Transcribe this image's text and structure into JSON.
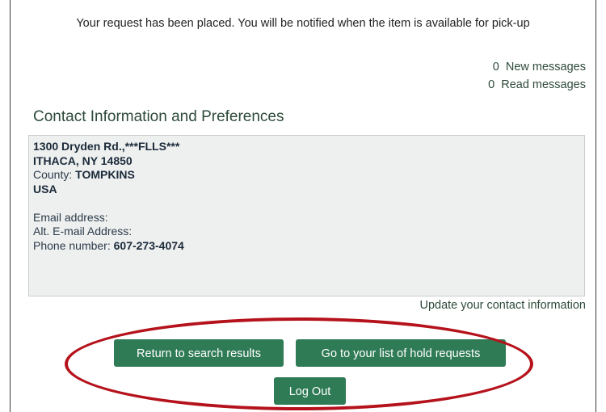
{
  "notice": "Your request has been placed. You will be notified when the item is available for pick-up",
  "messages": {
    "new_count": "0",
    "new_label": "New messages",
    "read_count": "0",
    "read_label": "Read messages"
  },
  "contact": {
    "title": "Contact Information and Preferences",
    "address_line1": "1300 Dryden Rd.,***FLLS***",
    "address_line2": "ITHACA, NY  14850",
    "county_label": "County: ",
    "county_value": "TOMPKINS",
    "country": "USA",
    "email_label": "Email address:",
    "alt_email_label": "Alt. E-mail Address:",
    "phone_label": "Phone number: ",
    "phone_value": "607-273-4074",
    "update_link": "Update your contact information"
  },
  "buttons": {
    "return_label": "Return to search results",
    "hold_label": "Go to your list of hold requests",
    "logout_label": "Log Out"
  },
  "colors": {
    "button_green": "#2f7b55",
    "highlight_red": "#b5121b",
    "text_green": "#2e4a3a"
  }
}
